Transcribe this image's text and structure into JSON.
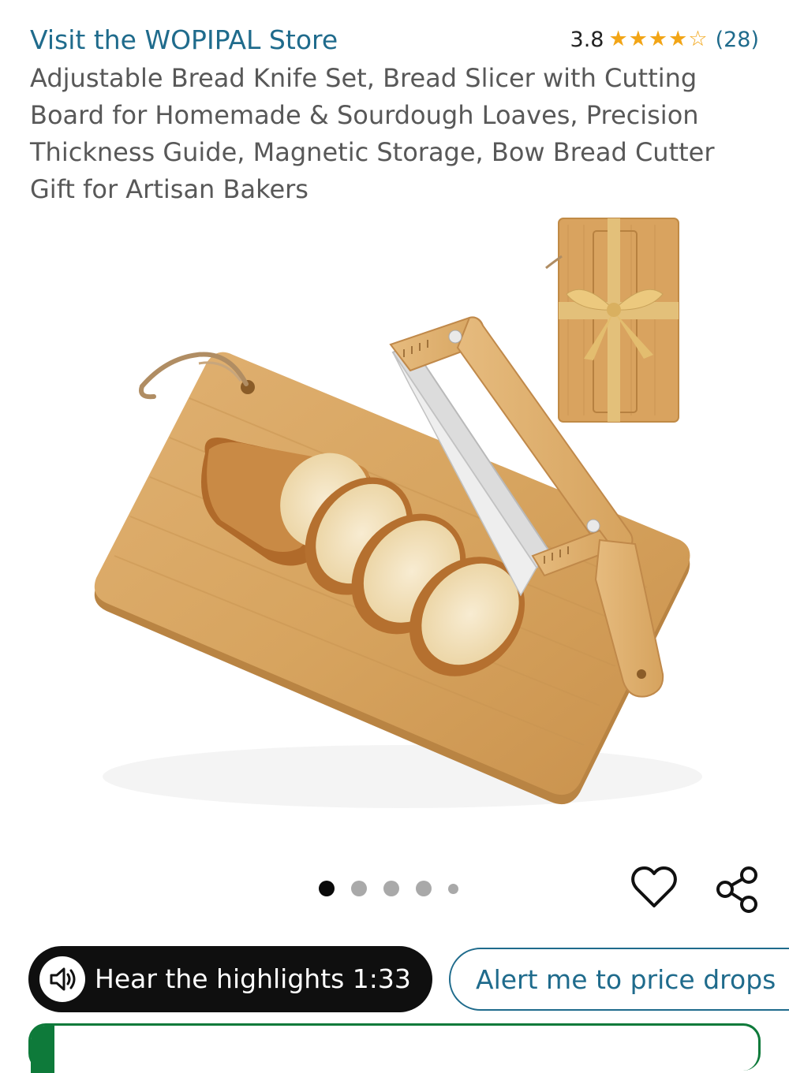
{
  "store": {
    "link_label": "Visit the WOPIPAL Store"
  },
  "rating": {
    "value": "3.8",
    "stars_filled": 4,
    "stars_total": 5,
    "count_label": "(28)",
    "star_color": "#f2a516"
  },
  "product": {
    "title": "Adjustable Bread Knife Set, Bread Slicer with Cutting Board for Homemade & Sourdough Loaves, Precision Thickness Guide, Magnetic Storage, Bow Bread Cutter Gift for Artisan Bakers"
  },
  "gallery": {
    "image_count": 5,
    "active_index": 0,
    "main_icon": "bread-slicer-cutting-board-image",
    "inset_icon": "gift-boxed-board-image"
  },
  "actions": {
    "wishlist_icon": "heart-icon",
    "share_icon": "share-icon"
  },
  "audio": {
    "label": "Hear the highlights 1:33",
    "icon": "speaker-icon"
  },
  "price_alert": {
    "label": "Alert me to price drops"
  },
  "colors": {
    "link": "#1f6b8c",
    "title_text": "#585858",
    "audio_bg": "#0f0f0f",
    "card_accent": "#0e7a3a"
  }
}
